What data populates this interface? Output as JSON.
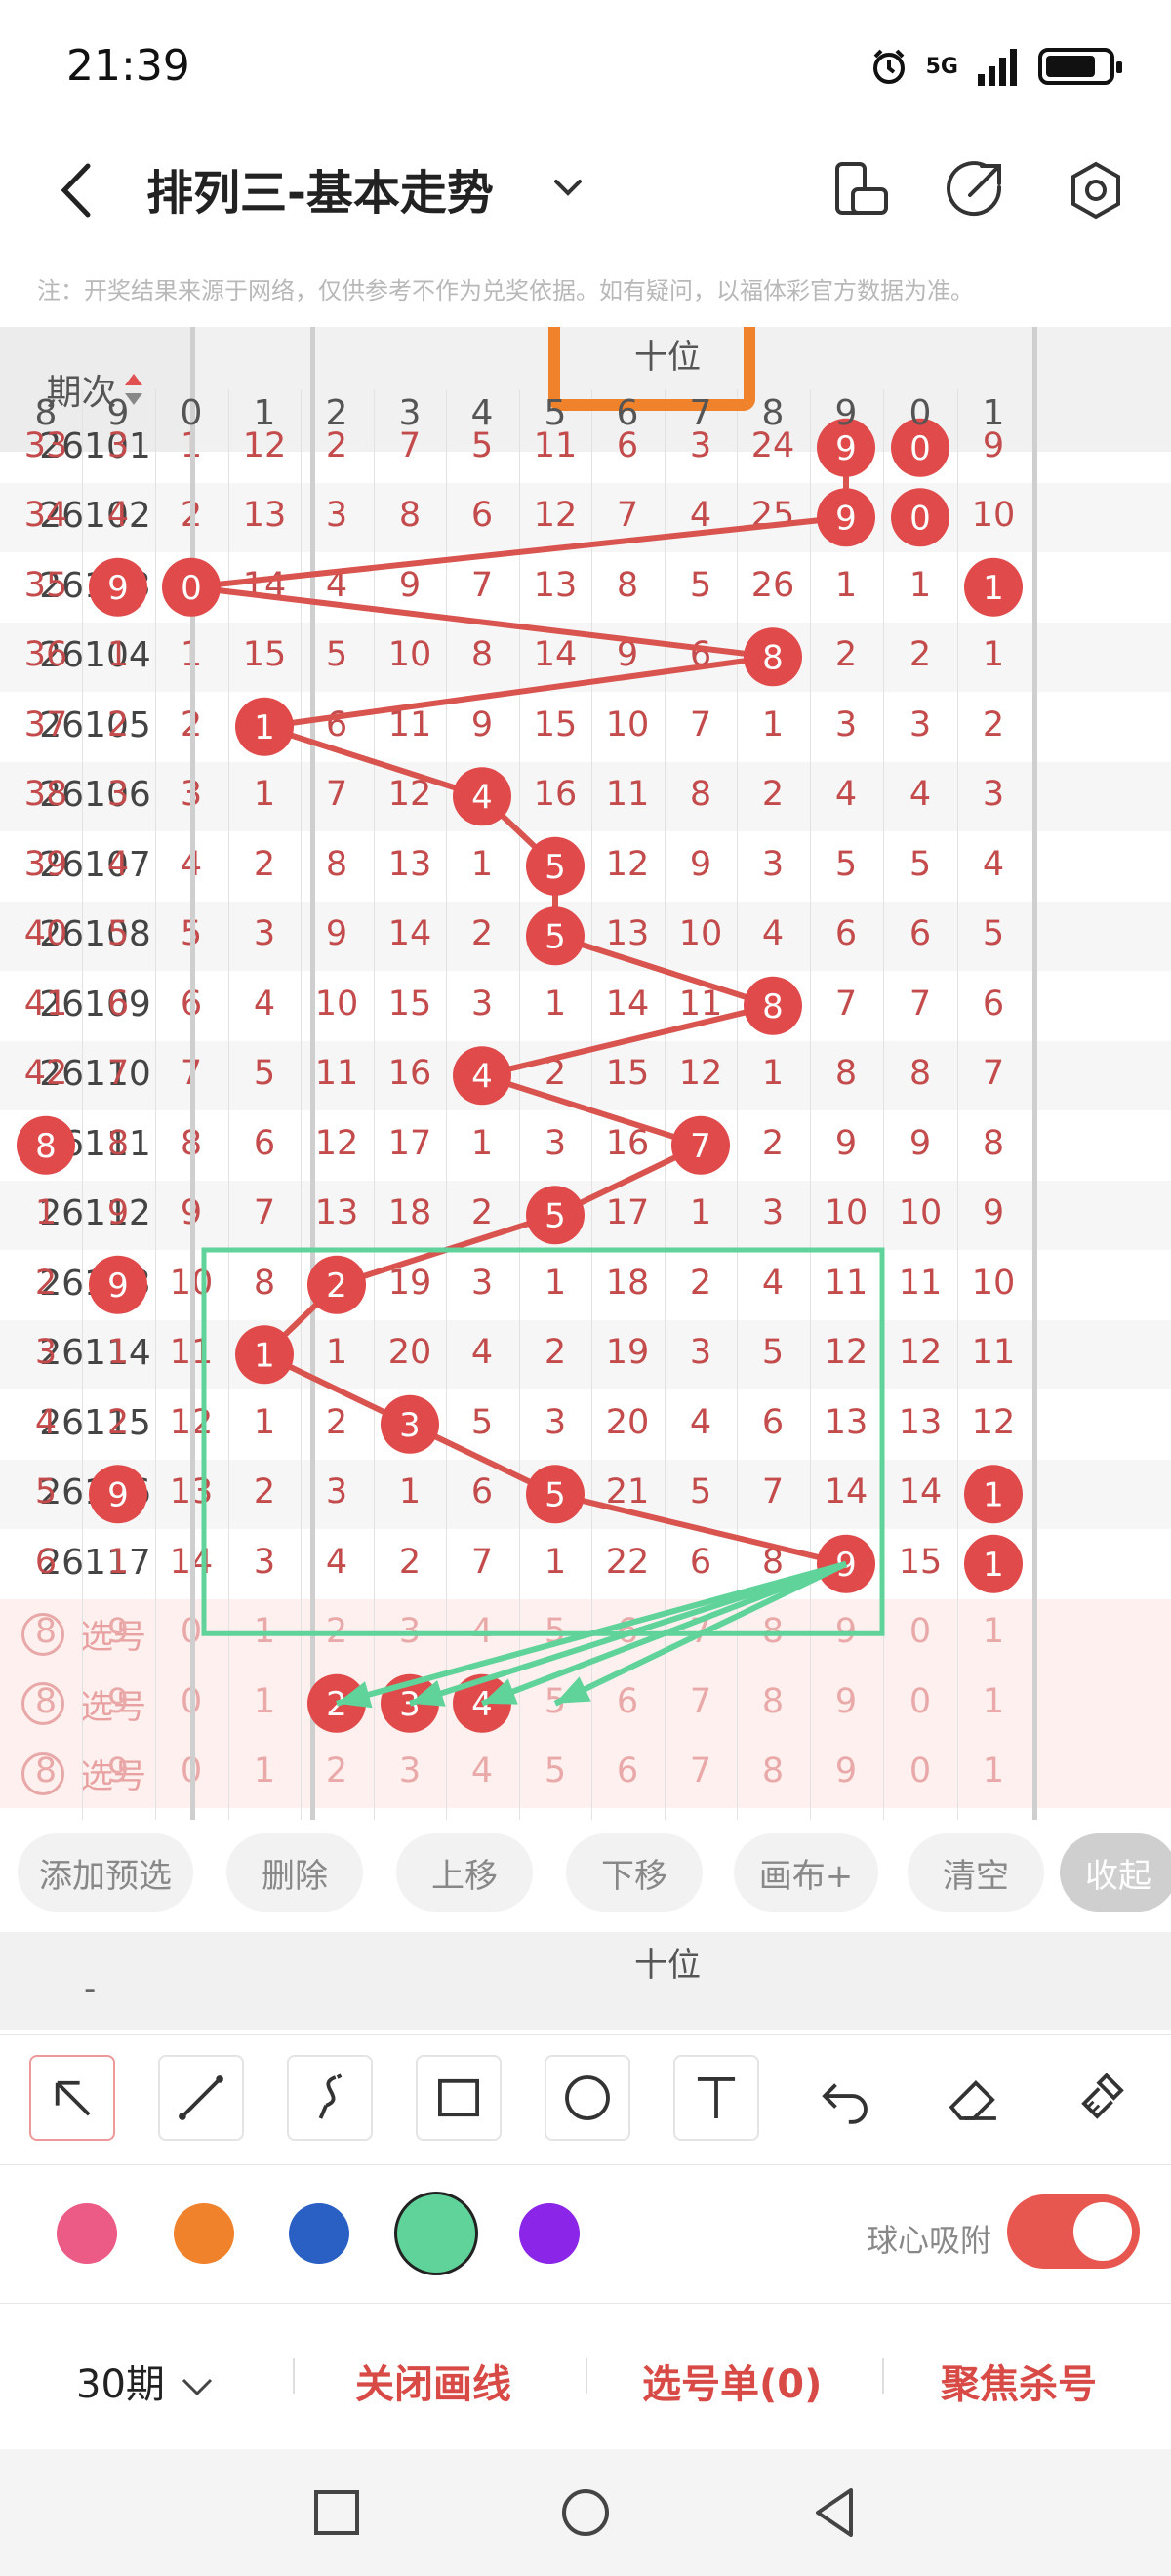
{
  "status": {
    "time": "21:39",
    "network": "5G"
  },
  "header": {
    "title": "排列三-基本走势"
  },
  "notice": "注：开奖结果来源于网络，仅供参考不作为兑奖依据。如有疑问，以福体彩官方数据为准。",
  "grid": {
    "period_header": "期次",
    "group_label": "十位",
    "digits_left": [
      "8",
      "9"
    ],
    "digits_main": [
      "0",
      "1",
      "2",
      "3",
      "4",
      "5",
      "6",
      "7",
      "8",
      "9"
    ],
    "digits_right": [
      "0",
      "1"
    ],
    "rows": [
      {
        "period": "26101",
        "cells": [
          "33",
          "3",
          "1",
          "12",
          "2",
          "7",
          "5",
          "11",
          "6",
          "3",
          "24",
          "9",
          "0",
          "9"
        ]
      },
      {
        "period": "26102",
        "cells": [
          "34",
          "4",
          "2",
          "13",
          "3",
          "8",
          "6",
          "12",
          "7",
          "4",
          "25",
          "9",
          "0",
          "10"
        ]
      },
      {
        "period": "26103",
        "cells": [
          "35",
          "9",
          "0",
          "14",
          "4",
          "9",
          "7",
          "13",
          "8",
          "5",
          "26",
          "1",
          "1",
          "1"
        ]
      },
      {
        "period": "26104",
        "cells": [
          "36",
          "1",
          "1",
          "15",
          "5",
          "10",
          "8",
          "14",
          "9",
          "6",
          "8",
          "2",
          "2",
          "1"
        ]
      },
      {
        "period": "26105",
        "cells": [
          "37",
          "2",
          "2",
          "1",
          "6",
          "11",
          "9",
          "15",
          "10",
          "7",
          "1",
          "3",
          "3",
          "2"
        ]
      },
      {
        "period": "26106",
        "cells": [
          "38",
          "3",
          "3",
          "1",
          "7",
          "12",
          "4",
          "16",
          "11",
          "8",
          "2",
          "4",
          "4",
          "3"
        ]
      },
      {
        "period": "26107",
        "cells": [
          "39",
          "4",
          "4",
          "2",
          "8",
          "13",
          "1",
          "5",
          "12",
          "9",
          "3",
          "5",
          "5",
          "4"
        ]
      },
      {
        "period": "26108",
        "cells": [
          "40",
          "5",
          "5",
          "3",
          "9",
          "14",
          "2",
          "5",
          "13",
          "10",
          "4",
          "6",
          "6",
          "5"
        ]
      },
      {
        "period": "26109",
        "cells": [
          "41",
          "6",
          "6",
          "4",
          "10",
          "15",
          "3",
          "1",
          "14",
          "11",
          "8",
          "7",
          "7",
          "6"
        ]
      },
      {
        "period": "26110",
        "cells": [
          "42",
          "7",
          "7",
          "5",
          "11",
          "16",
          "4",
          "2",
          "15",
          "12",
          "1",
          "8",
          "8",
          "7"
        ]
      },
      {
        "period": "26111",
        "cells": [
          "8",
          "8",
          "8",
          "6",
          "12",
          "17",
          "1",
          "3",
          "16",
          "7",
          "2",
          "9",
          "9",
          "8"
        ]
      },
      {
        "period": "26112",
        "cells": [
          "1",
          "9",
          "9",
          "7",
          "13",
          "18",
          "2",
          "5",
          "17",
          "1",
          "3",
          "10",
          "10",
          "9"
        ]
      },
      {
        "period": "26113",
        "cells": [
          "2",
          "9",
          "10",
          "8",
          "2",
          "19",
          "3",
          "1",
          "18",
          "2",
          "4",
          "11",
          "11",
          "10"
        ]
      },
      {
        "period": "26114",
        "cells": [
          "3",
          "1",
          "11",
          "1",
          "1",
          "20",
          "4",
          "2",
          "19",
          "3",
          "5",
          "12",
          "12",
          "11"
        ]
      },
      {
        "period": "26115",
        "cells": [
          "4",
          "2",
          "12",
          "1",
          "2",
          "3",
          "5",
          "3",
          "20",
          "4",
          "6",
          "13",
          "13",
          "12"
        ]
      },
      {
        "period": "26116",
        "cells": [
          "5",
          "9",
          "13",
          "2",
          "3",
          "1",
          "6",
          "5",
          "21",
          "5",
          "7",
          "14",
          "14",
          "1"
        ]
      },
      {
        "period": "26117",
        "cells": [
          "6",
          "1",
          "14",
          "3",
          "4",
          "2",
          "7",
          "1",
          "22",
          "6",
          "8",
          "9",
          "15",
          "1"
        ]
      }
    ],
    "select_label": "选号",
    "select_rows": [
      [
        "8",
        "9",
        "0",
        "1",
        "2",
        "3",
        "4",
        "5",
        "6",
        "7",
        "8",
        "9",
        "0",
        "1"
      ],
      [
        "8",
        "9",
        "0",
        "1",
        "2",
        "3",
        "4",
        "5",
        "6",
        "7",
        "8",
        "9",
        "0",
        "1"
      ],
      [
        "8",
        "9",
        "0",
        "1",
        "2",
        "3",
        "4",
        "5",
        "6",
        "7",
        "8",
        "9",
        "0",
        "1"
      ]
    ]
  },
  "actions": [
    "添加预选",
    "删除",
    "上移",
    "下移",
    "画布+",
    "清空",
    "收起"
  ],
  "sub_header": {
    "dash": "-",
    "group_label": "十位"
  },
  "colors": [
    "#ec5a86",
    "#f0822b",
    "#2a5fc4",
    "#5fd39a",
    "#8b25e8"
  ],
  "snap": {
    "label": "球心吸附",
    "on": true
  },
  "bottom": {
    "period": "30期",
    "close_draw": "关闭画线",
    "pick_list": "选号单(0)",
    "focus_kill": "聚焦杀号"
  }
}
